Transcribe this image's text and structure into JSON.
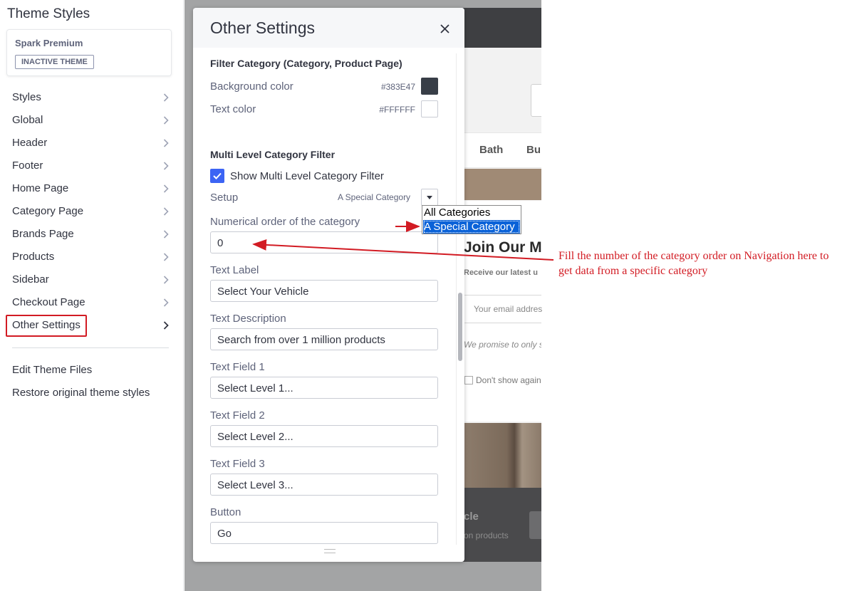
{
  "sidebar": {
    "title": "Theme Styles",
    "theme_name": "Spark Premium",
    "theme_badge": "INACTIVE THEME",
    "items": [
      {
        "label": "Styles"
      },
      {
        "label": "Global"
      },
      {
        "label": "Header"
      },
      {
        "label": "Footer"
      },
      {
        "label": "Home Page"
      },
      {
        "label": "Category Page"
      },
      {
        "label": "Brands Page"
      },
      {
        "label": "Products"
      },
      {
        "label": "Sidebar"
      },
      {
        "label": "Checkout Page"
      },
      {
        "label": "Other Settings"
      }
    ],
    "active_item": "Other Settings",
    "links": {
      "edit": "Edit Theme Files",
      "restore": "Restore original theme styles"
    }
  },
  "panel": {
    "title": "Other Settings",
    "filter_category": {
      "title": "Filter Category (Category, Product Page)",
      "background_label": "Background color",
      "background_hex": "#383E47",
      "text_label": "Text color",
      "text_hex": "#FFFFFF"
    },
    "multi_level": {
      "title": "Multi Level Category Filter",
      "show_label": "Show Multi Level Category Filter",
      "show_checked": true,
      "setup_label": "Setup",
      "setup_value": "A Special Category",
      "setup_options": [
        "All Categories",
        "A Special Category"
      ],
      "order_label": "Numerical order of the category",
      "order_value": "0",
      "text_label_label": "Text Label",
      "text_label_value": "Select Your Vehicle",
      "text_description_label": "Text Description",
      "text_description_value": "Search from over 1 million products",
      "field1_label": "Text Field 1",
      "field1_value": "Select Level 1...",
      "field2_label": "Text Field 2",
      "field2_value": "Select Level 2...",
      "field3_label": "Text Field 3",
      "field3_value": "Select Level 3...",
      "button_label": "Button",
      "button_value": "Go"
    }
  },
  "preview": {
    "nav1": "Bath",
    "nav2": "Bu",
    "join_title": "Join Our M",
    "receive": "Receive our latest u",
    "email_placeholder": "Your email addres",
    "promise": "We promise to only s",
    "dont_show": "Don't show again",
    "footer_title": "cle",
    "footer_sub": "on products"
  },
  "annotation": {
    "text": "Fill the number of the category order on Navigation here to get data from a specific category",
    "color": "#d21b23"
  },
  "colors": {
    "accent": "#3c64f4",
    "highlight": "#d21b23",
    "swatch_dark": "#383E47",
    "swatch_light": "#FFFFFF"
  }
}
